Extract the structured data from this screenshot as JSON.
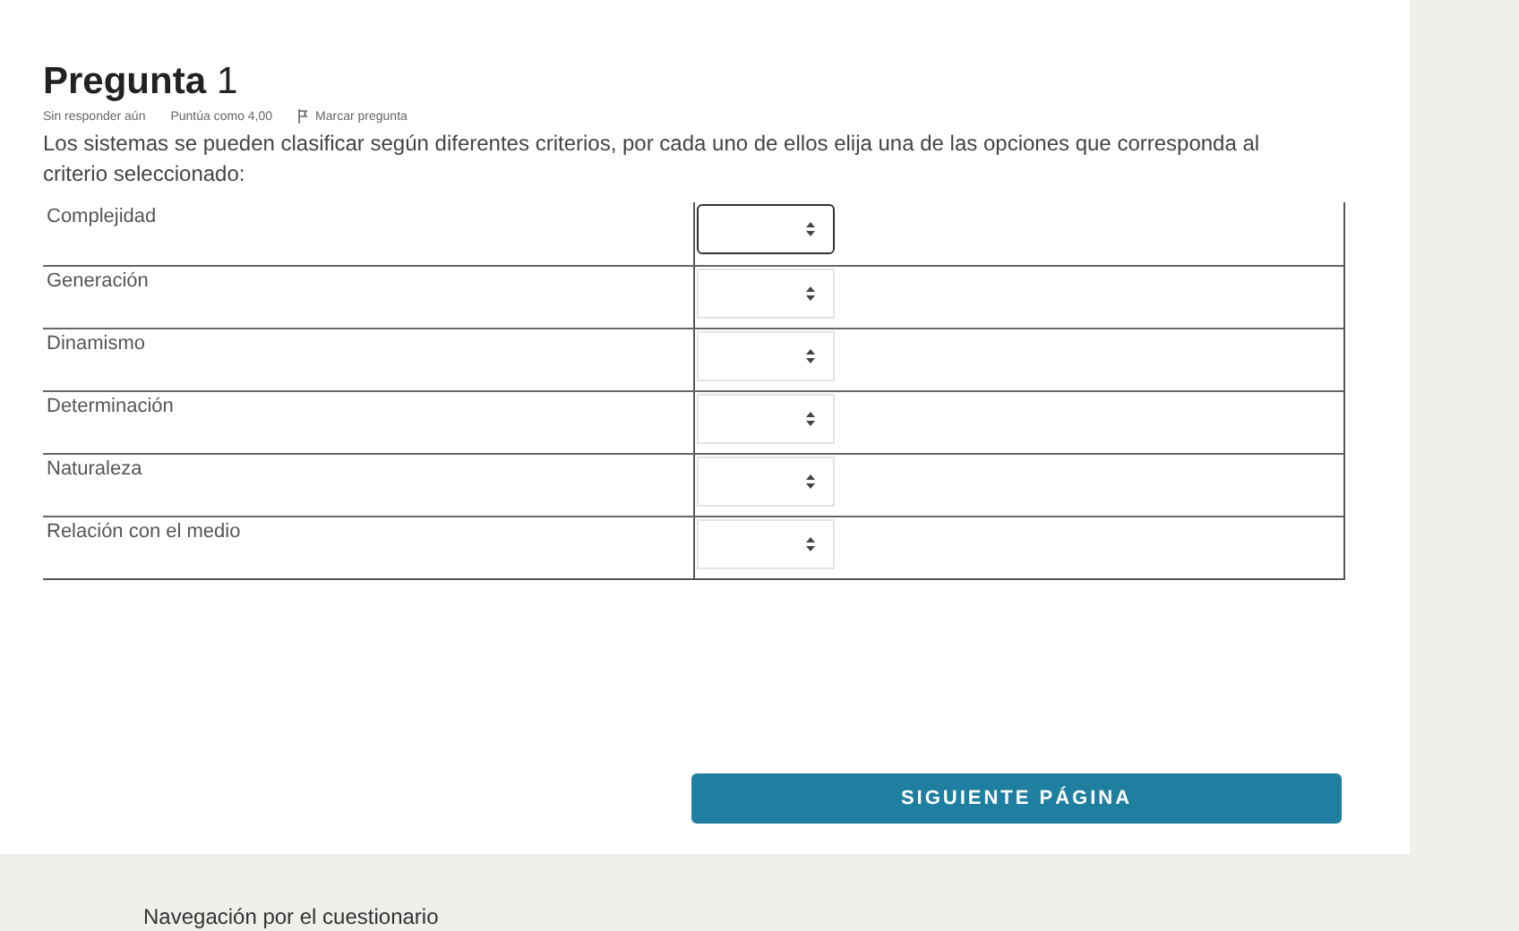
{
  "question": {
    "title": "Pregunta",
    "number": "1",
    "status": "Sin responder aún",
    "score": "Puntúa como 4,00",
    "flag_label": "Marcar pregunta",
    "text": "Los sistemas se pueden clasificar según diferentes criterios, por cada uno de ellos elija una de las opciones que corresponda al criterio seleccionado:"
  },
  "rows": [
    {
      "label": "Complejidad",
      "focused": true
    },
    {
      "label": "Generación",
      "focused": false
    },
    {
      "label": "Dinamismo",
      "focused": false
    },
    {
      "label": "Determinación",
      "focused": false
    },
    {
      "label": "Naturaleza",
      "focused": false
    },
    {
      "label": "Relación con el medio",
      "focused": false
    }
  ],
  "next_button": "SIGUIENTE PÁGINA",
  "navigation_title": "Navegación por el cuestionario"
}
